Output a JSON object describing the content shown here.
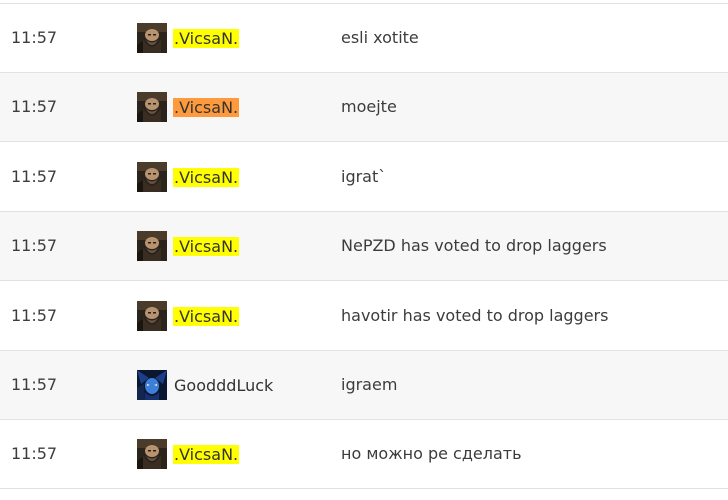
{
  "colors": {
    "highlight_yellow": "#ffff00",
    "highlight_orange": "#ff9a3c",
    "row_alt_bg": "#f7f7f7",
    "divider": "#e2e2e2"
  },
  "messages": [
    {
      "time": "11:57",
      "player": ".VicsaN.",
      "avatar": "bearded-warrior-avatar",
      "highlight": "yellow",
      "text": "esli xotite"
    },
    {
      "time": "11:57",
      "player": ".VicsaN.",
      "avatar": "bearded-warrior-avatar",
      "highlight": "orange",
      "text": "moejte"
    },
    {
      "time": "11:57",
      "player": ".VicsaN.",
      "avatar": "bearded-warrior-avatar",
      "highlight": "yellow",
      "text": "igrat`"
    },
    {
      "time": "11:57",
      "player": ".VicsaN.",
      "avatar": "bearded-warrior-avatar",
      "highlight": "yellow",
      "text": "NePZD has voted to drop laggers"
    },
    {
      "time": "11:57",
      "player": ".VicsaN.",
      "avatar": "bearded-warrior-avatar",
      "highlight": "yellow",
      "text": "havotir has voted to drop laggers"
    },
    {
      "time": "11:57",
      "player": "GoodddLuck",
      "avatar": "blue-night-elf-avatar",
      "highlight": "none",
      "text": "igraem"
    },
    {
      "time": "11:57",
      "player": ".VicsaN.",
      "avatar": "bearded-warrior-avatar",
      "highlight": "yellow",
      "text": "но можно ре сделать"
    }
  ]
}
